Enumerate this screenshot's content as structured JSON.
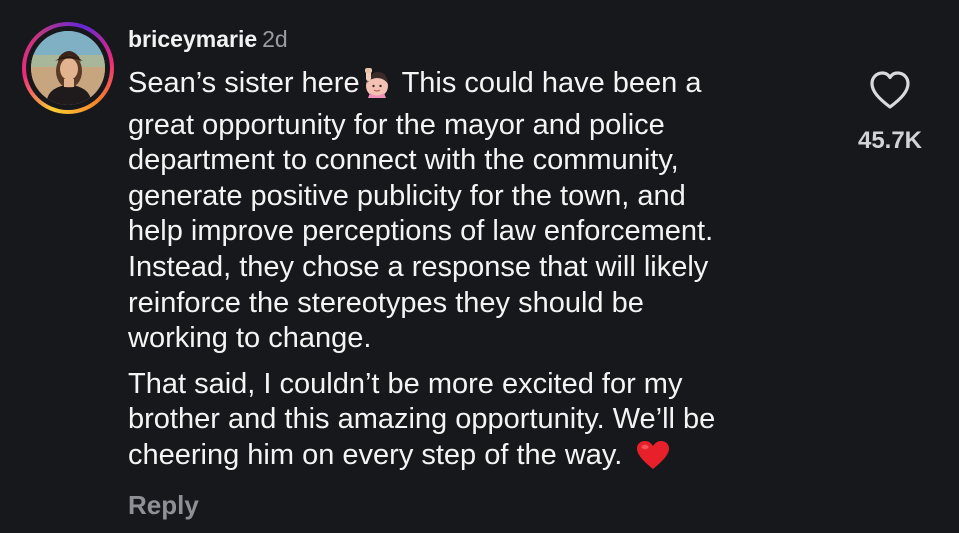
{
  "comment": {
    "username": "briceymarie",
    "timestamp": "2d",
    "avatar_icon": "profile-photo",
    "paragraphs": [
      {
        "lines": [
          "Sean’s sister here",
          "great opportunity for the mayor and police",
          "department to connect with the community,",
          "generate positive publicity for the town, and",
          "help improve perceptions of law enforcement.",
          "Instead, they chose a response that will likely",
          "reinforce the stereotypes they should be",
          "working to change."
        ],
        "line1_after_emoji": "This could have been a",
        "inline_emoji": "raising-hand-emoji"
      },
      {
        "lines": [
          "That said, I couldn’t be more excited for my",
          "brother and this amazing opportunity. We’ll be",
          "cheering him on every step of the way."
        ],
        "trailing_emoji": "red-heart-emoji"
      }
    ],
    "reply_label": "Reply",
    "like_icon": "heart-outline-icon",
    "like_count": "45.7K",
    "colors": {
      "background": "#16181c",
      "text": "#f4f4f4",
      "muted": "#9a9ca1",
      "heart": "#e8202a",
      "story_ring": [
        "#f9ce34",
        "#ee2a7b",
        "#6228d7"
      ]
    }
  }
}
